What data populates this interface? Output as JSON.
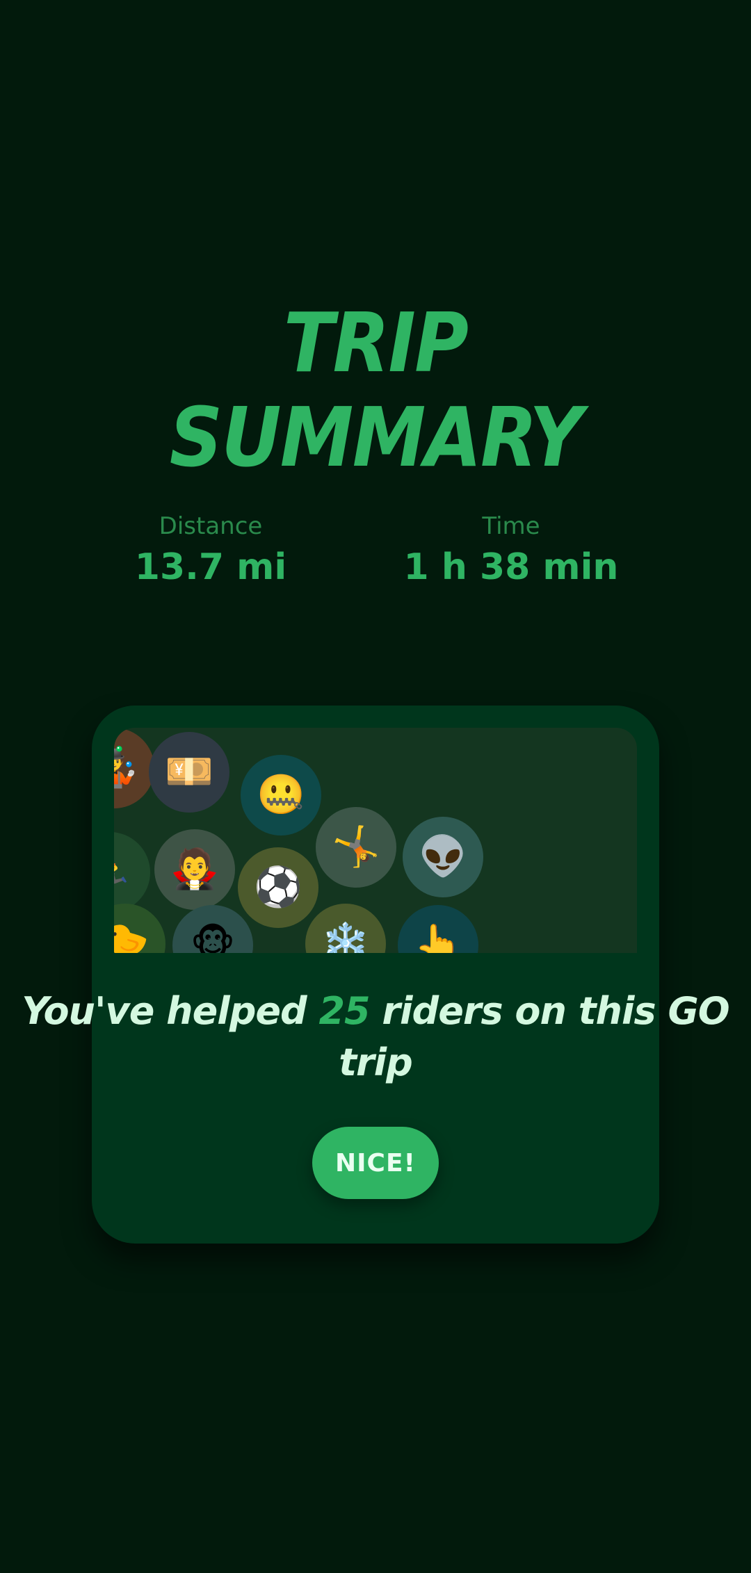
{
  "title": {
    "line1": "TRIP",
    "line2": "SUMMARY"
  },
  "stats": {
    "distance": {
      "label": "Distance",
      "value": "13.7 mi"
    },
    "time": {
      "label": "Time",
      "value": "1 h 38 min"
    }
  },
  "card": {
    "message_prefix": "You've helped ",
    "riders_count": "25",
    "message_suffix": " riders on this GO trip",
    "button_label": "NICE!"
  },
  "bubbles": [
    {
      "icon": "person-juggling-icon",
      "glyph": "🤹"
    },
    {
      "icon": "money-with-wings-icon",
      "glyph": "💴"
    },
    {
      "icon": "zipper-mouth-face-icon",
      "glyph": "🤐"
    },
    {
      "icon": "person-running-icon",
      "glyph": "🏃"
    },
    {
      "icon": "woman-vampire-icon",
      "glyph": "🧛"
    },
    {
      "icon": "person-cartwheel-icon",
      "glyph": "🤸"
    },
    {
      "icon": "alien-icon",
      "glyph": "👽"
    },
    {
      "icon": "soccer-ball-icon",
      "glyph": "⚽"
    },
    {
      "icon": "baby-chick-icon",
      "glyph": "🐤"
    },
    {
      "icon": "monkey-icon",
      "glyph": "🐵"
    },
    {
      "icon": "snowflake-icon",
      "glyph": "❄️"
    },
    {
      "icon": "pointing-hand-icon",
      "glyph": "👆"
    }
  ],
  "colors": {
    "background": "#021a0c",
    "accent": "#2fb463",
    "card": "#00361c",
    "message_text": "#d4f8e0"
  }
}
